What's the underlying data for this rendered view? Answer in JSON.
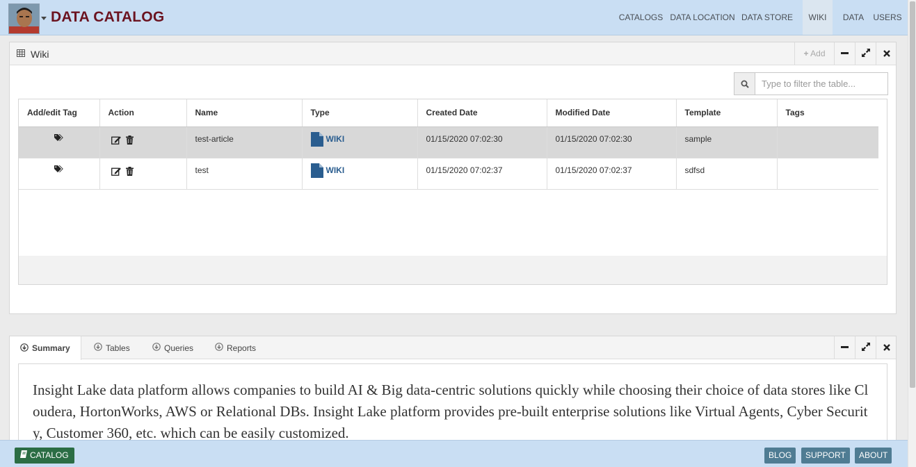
{
  "header": {
    "brand": "DATA CATALOG",
    "nav": [
      "CATALOGS",
      "DATA LOCATION",
      "DATA STORE",
      "WIKI",
      "DATA",
      "USERS"
    ],
    "active_nav": "WIKI"
  },
  "wiki_panel": {
    "title": "Wiki",
    "add_label": "Add",
    "filter_placeholder": "Type to filter the table...",
    "columns": [
      "Add/edit Tag",
      "Action",
      "Name",
      "Type",
      "Created Date",
      "Modified Date",
      "Template",
      "Tags"
    ],
    "rows": [
      {
        "name": "test-article",
        "type": "WIKI",
        "created": "01/15/2020 07:02:30",
        "modified": "01/15/2020 07:02:30",
        "template": "sample",
        "tags": ""
      },
      {
        "name": "test",
        "type": "WIKI",
        "created": "01/15/2020 07:02:37",
        "modified": "01/15/2020 07:02:37",
        "template": "sdfsd",
        "tags": ""
      }
    ]
  },
  "info_panel": {
    "tabs": [
      "Summary",
      "Tables",
      "Queries",
      "Reports"
    ],
    "active_tab": "Summary",
    "summary": "Insight Lake data platform allows companies to build AI & Big data-centric solutions quickly while choosing their choice of data stores like Cloudera, HortonWorks, AWS or Relational DBs. Insight Lake platform provides pre-built enterprise solutions like Virtual Agents, Cyber Security, Customer 360, etc. which can be easily customized."
  },
  "footer": {
    "catalog_label": "CATALOG",
    "buttons": [
      "BLOG",
      "SUPPORT",
      "ABOUT"
    ]
  },
  "colors": {
    "navbar_bg": "#c9def3",
    "brand": "#6b1320",
    "catalog_button": "#2b6d44",
    "footer_button": "#4f7c93",
    "wiki_link": "#2a5d8f"
  }
}
